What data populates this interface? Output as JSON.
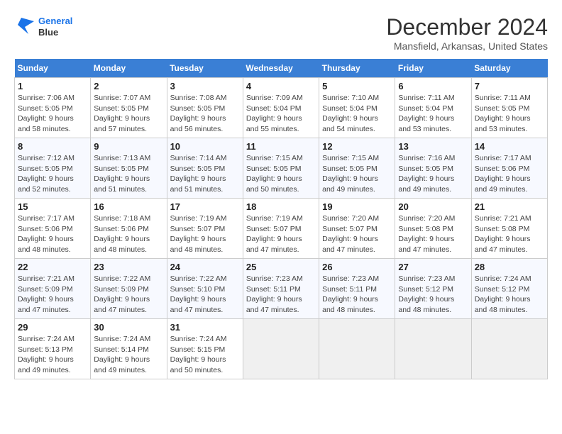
{
  "header": {
    "logo_line1": "General",
    "logo_line2": "Blue",
    "month_title": "December 2024",
    "location": "Mansfield, Arkansas, United States"
  },
  "calendar": {
    "days_of_week": [
      "Sunday",
      "Monday",
      "Tuesday",
      "Wednesday",
      "Thursday",
      "Friday",
      "Saturday"
    ],
    "weeks": [
      [
        {
          "day": "1",
          "sunrise": "7:06 AM",
          "sunset": "5:05 PM",
          "daylight": "9 hours and 58 minutes."
        },
        {
          "day": "2",
          "sunrise": "7:07 AM",
          "sunset": "5:05 PM",
          "daylight": "9 hours and 57 minutes."
        },
        {
          "day": "3",
          "sunrise": "7:08 AM",
          "sunset": "5:05 PM",
          "daylight": "9 hours and 56 minutes."
        },
        {
          "day": "4",
          "sunrise": "7:09 AM",
          "sunset": "5:04 PM",
          "daylight": "9 hours and 55 minutes."
        },
        {
          "day": "5",
          "sunrise": "7:10 AM",
          "sunset": "5:04 PM",
          "daylight": "9 hours and 54 minutes."
        },
        {
          "day": "6",
          "sunrise": "7:11 AM",
          "sunset": "5:04 PM",
          "daylight": "9 hours and 53 minutes."
        },
        {
          "day": "7",
          "sunrise": "7:11 AM",
          "sunset": "5:05 PM",
          "daylight": "9 hours and 53 minutes."
        }
      ],
      [
        {
          "day": "8",
          "sunrise": "7:12 AM",
          "sunset": "5:05 PM",
          "daylight": "9 hours and 52 minutes."
        },
        {
          "day": "9",
          "sunrise": "7:13 AM",
          "sunset": "5:05 PM",
          "daylight": "9 hours and 51 minutes."
        },
        {
          "day": "10",
          "sunrise": "7:14 AM",
          "sunset": "5:05 PM",
          "daylight": "9 hours and 51 minutes."
        },
        {
          "day": "11",
          "sunrise": "7:15 AM",
          "sunset": "5:05 PM",
          "daylight": "9 hours and 50 minutes."
        },
        {
          "day": "12",
          "sunrise": "7:15 AM",
          "sunset": "5:05 PM",
          "daylight": "9 hours and 49 minutes."
        },
        {
          "day": "13",
          "sunrise": "7:16 AM",
          "sunset": "5:05 PM",
          "daylight": "9 hours and 49 minutes."
        },
        {
          "day": "14",
          "sunrise": "7:17 AM",
          "sunset": "5:06 PM",
          "daylight": "9 hours and 49 minutes."
        }
      ],
      [
        {
          "day": "15",
          "sunrise": "7:17 AM",
          "sunset": "5:06 PM",
          "daylight": "9 hours and 48 minutes."
        },
        {
          "day": "16",
          "sunrise": "7:18 AM",
          "sunset": "5:06 PM",
          "daylight": "9 hours and 48 minutes."
        },
        {
          "day": "17",
          "sunrise": "7:19 AM",
          "sunset": "5:07 PM",
          "daylight": "9 hours and 48 minutes."
        },
        {
          "day": "18",
          "sunrise": "7:19 AM",
          "sunset": "5:07 PM",
          "daylight": "9 hours and 47 minutes."
        },
        {
          "day": "19",
          "sunrise": "7:20 AM",
          "sunset": "5:07 PM",
          "daylight": "9 hours and 47 minutes."
        },
        {
          "day": "20",
          "sunrise": "7:20 AM",
          "sunset": "5:08 PM",
          "daylight": "9 hours and 47 minutes."
        },
        {
          "day": "21",
          "sunrise": "7:21 AM",
          "sunset": "5:08 PM",
          "daylight": "9 hours and 47 minutes."
        }
      ],
      [
        {
          "day": "22",
          "sunrise": "7:21 AM",
          "sunset": "5:09 PM",
          "daylight": "9 hours and 47 minutes."
        },
        {
          "day": "23",
          "sunrise": "7:22 AM",
          "sunset": "5:09 PM",
          "daylight": "9 hours and 47 minutes."
        },
        {
          "day": "24",
          "sunrise": "7:22 AM",
          "sunset": "5:10 PM",
          "daylight": "9 hours and 47 minutes."
        },
        {
          "day": "25",
          "sunrise": "7:23 AM",
          "sunset": "5:11 PM",
          "daylight": "9 hours and 47 minutes."
        },
        {
          "day": "26",
          "sunrise": "7:23 AM",
          "sunset": "5:11 PM",
          "daylight": "9 hours and 48 minutes."
        },
        {
          "day": "27",
          "sunrise": "7:23 AM",
          "sunset": "5:12 PM",
          "daylight": "9 hours and 48 minutes."
        },
        {
          "day": "28",
          "sunrise": "7:24 AM",
          "sunset": "5:12 PM",
          "daylight": "9 hours and 48 minutes."
        }
      ],
      [
        {
          "day": "29",
          "sunrise": "7:24 AM",
          "sunset": "5:13 PM",
          "daylight": "9 hours and 49 minutes."
        },
        {
          "day": "30",
          "sunrise": "7:24 AM",
          "sunset": "5:14 PM",
          "daylight": "9 hours and 49 minutes."
        },
        {
          "day": "31",
          "sunrise": "7:24 AM",
          "sunset": "5:15 PM",
          "daylight": "9 hours and 50 minutes."
        },
        null,
        null,
        null,
        null
      ]
    ]
  }
}
